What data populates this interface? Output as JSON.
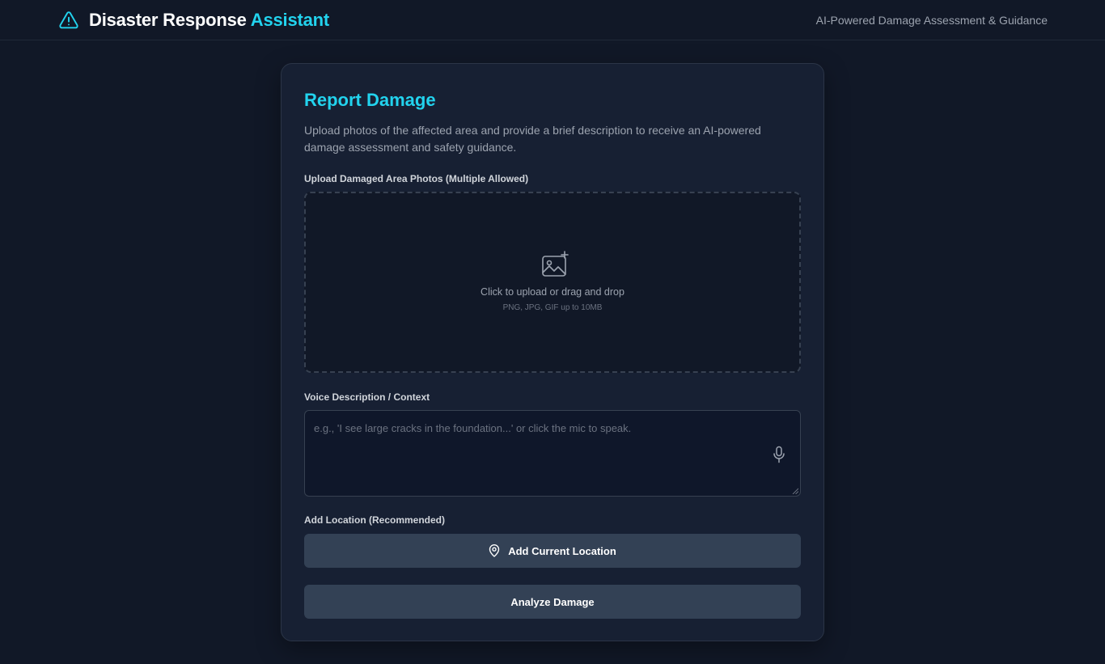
{
  "header": {
    "title_primary": "Disaster Response",
    "title_accent": "Assistant",
    "tagline": "AI-Powered Damage Assessment & Guidance",
    "icon": "warning-triangle-icon"
  },
  "card": {
    "title": "Report Damage",
    "description": "Upload photos of the affected area and provide a brief description to receive an AI-powered damage assessment and safety guidance."
  },
  "upload": {
    "label": "Upload Damaged Area Photos (Multiple Allowed)",
    "icon": "image-add-icon",
    "prompt": "Click to upload or drag and drop",
    "hint": "PNG, JPG, GIF up to 10MB"
  },
  "voice": {
    "label": "Voice Description / Context",
    "value": "",
    "placeholder": "e.g., 'I see large cracks in the foundation...' or click the mic to speak.",
    "icon": "microphone-icon"
  },
  "location": {
    "label": "Add Location (Recommended)",
    "button_label": "Add Current Location",
    "icon": "map-pin-icon"
  },
  "analyze": {
    "button_label": "Analyze Damage"
  },
  "colors": {
    "background": "#111827",
    "card": "#172033",
    "accent": "#22d3ee",
    "button": "#334155"
  }
}
